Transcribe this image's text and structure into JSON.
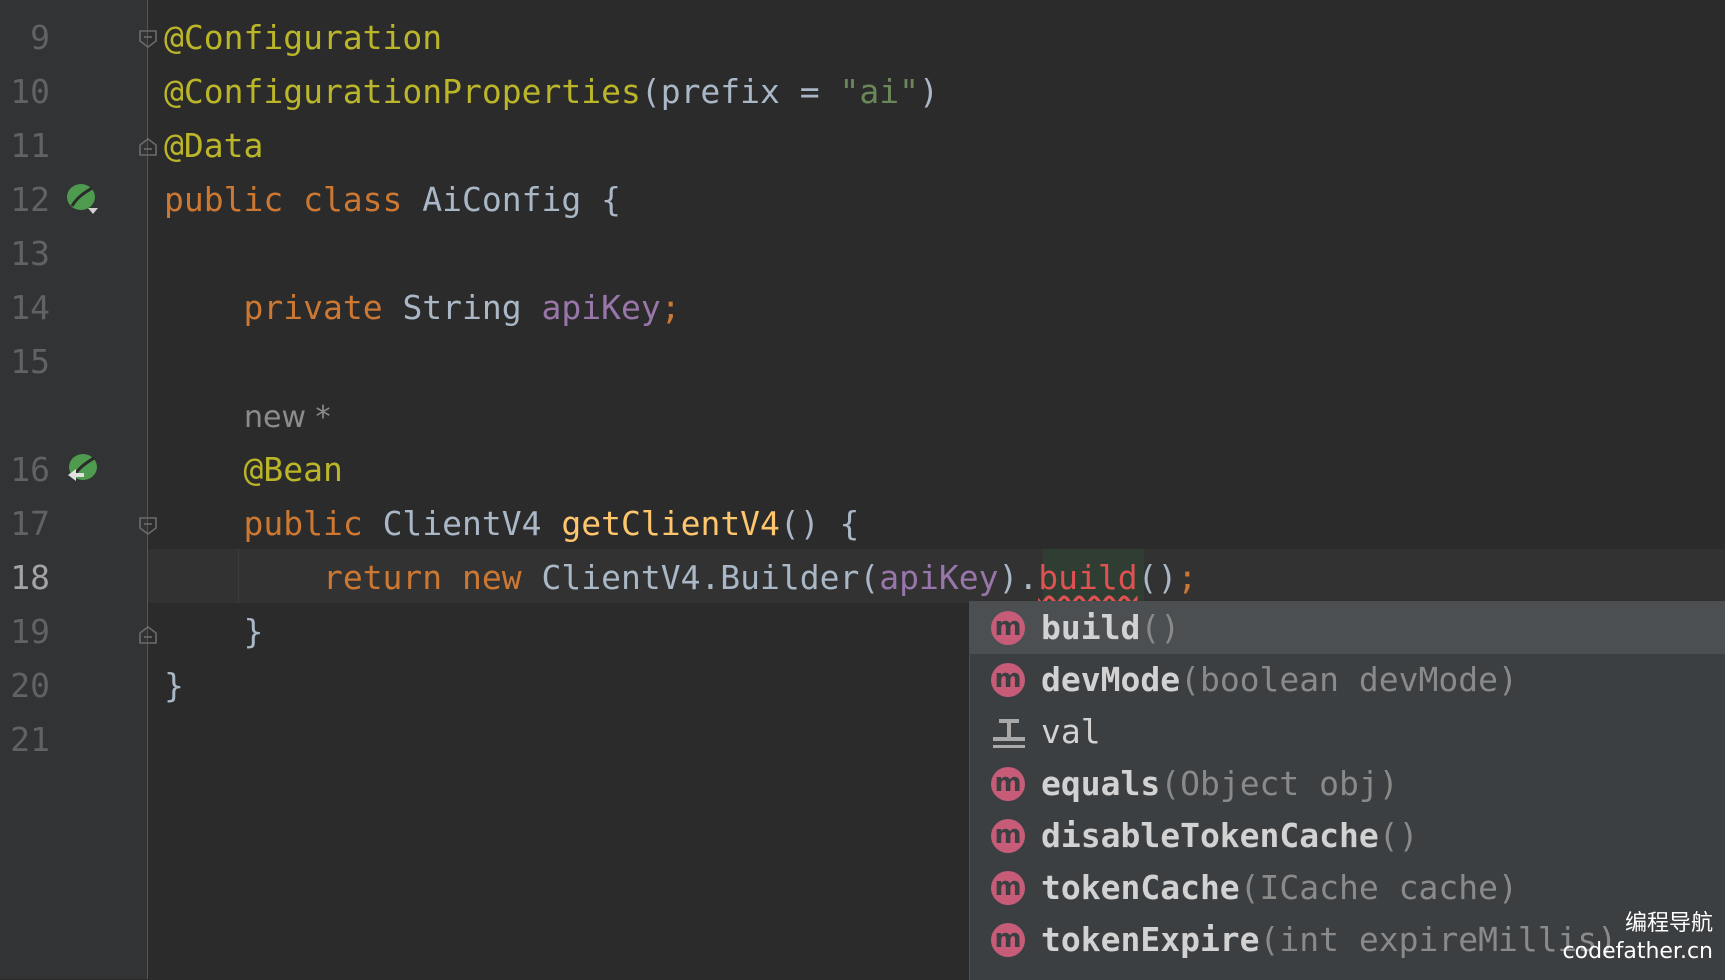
{
  "editor": {
    "lines": [
      {
        "num": "9",
        "tokens": [
          {
            "t": "@Configuration",
            "c": "ann"
          }
        ]
      },
      {
        "num": "10",
        "tokens": [
          {
            "t": "@ConfigurationProperties",
            "c": "ann"
          },
          {
            "t": "(prefix = ",
            "c": ""
          },
          {
            "t": "\"ai\"",
            "c": "str"
          },
          {
            "t": ")",
            "c": ""
          }
        ]
      },
      {
        "num": "11",
        "tokens": [
          {
            "t": "@Data",
            "c": "ann"
          }
        ]
      },
      {
        "num": "12",
        "tokens": [
          {
            "t": "public class ",
            "c": "kw"
          },
          {
            "t": "AiConfig {",
            "c": ""
          }
        ]
      },
      {
        "num": "13",
        "tokens": []
      },
      {
        "num": "14",
        "tokens": [
          {
            "t": "    "
          },
          {
            "t": "private ",
            "c": "kw"
          },
          {
            "t": "String ",
            "c": ""
          },
          {
            "t": "apiKey",
            "c": "fld"
          },
          {
            "t": ";",
            "c": "kw"
          }
        ]
      },
      {
        "num": "15",
        "tokens": []
      },
      {
        "num": "16",
        "tokens": [
          {
            "t": "    "
          },
          {
            "t": "@Bean",
            "c": "ann"
          }
        ]
      },
      {
        "num": "17",
        "tokens": [
          {
            "t": "    "
          },
          {
            "t": "public ",
            "c": "kw"
          },
          {
            "t": "ClientV4 ",
            "c": ""
          },
          {
            "t": "getClientV4",
            "c": "fn"
          },
          {
            "t": "() {",
            "c": ""
          }
        ]
      },
      {
        "num": "18",
        "tokens": [
          {
            "t": "        "
          },
          {
            "t": "return new ",
            "c": "kw"
          },
          {
            "t": "ClientV4.Builder(",
            "c": ""
          },
          {
            "t": "apiKey",
            "c": "fld"
          },
          {
            "t": ").",
            "c": ""
          },
          {
            "t": "build",
            "c": "err"
          },
          {
            "t": "()",
            "c": ""
          },
          {
            "t": ";",
            "c": "kw"
          }
        ]
      },
      {
        "num": "19",
        "tokens": [
          {
            "t": "    }",
            "c": ""
          }
        ]
      },
      {
        "num": "20",
        "tokens": [
          {
            "t": "}",
            "c": ""
          }
        ]
      },
      {
        "num": "21",
        "tokens": []
      }
    ],
    "inlay_hint": "new *",
    "current_line": "18"
  },
  "completion": {
    "items": [
      {
        "icon": "method-icon",
        "badge": "m",
        "name": "build",
        "sig": "()",
        "selected": true
      },
      {
        "icon": "method-icon",
        "badge": "m",
        "name": "devMode",
        "sig": "(boolean devMode)"
      },
      {
        "icon": "live-template-icon",
        "badge": "",
        "name": "val",
        "sig": ""
      },
      {
        "icon": "method-icon",
        "badge": "m",
        "name": "equals",
        "sig": "(Object obj)"
      },
      {
        "icon": "method-icon",
        "badge": "m",
        "name": "disableTokenCache",
        "sig": "()"
      },
      {
        "icon": "method-icon",
        "badge": "m",
        "name": "tokenCache",
        "sig": "(ICache cache)"
      },
      {
        "icon": "method-icon",
        "badge": "m",
        "name": "tokenExpire",
        "sig": "(int expireMillis)"
      }
    ]
  },
  "watermark": {
    "line1": "编程导航",
    "line2": "codefather.cn"
  },
  "colors": {
    "background": "#2b2b2b",
    "keyword": "#cc7832",
    "annotation": "#bbb529",
    "string": "#6a8759",
    "field": "#9876aa",
    "method": "#ffc66d",
    "error": "#e05252",
    "method_badge": "#c75c78"
  }
}
